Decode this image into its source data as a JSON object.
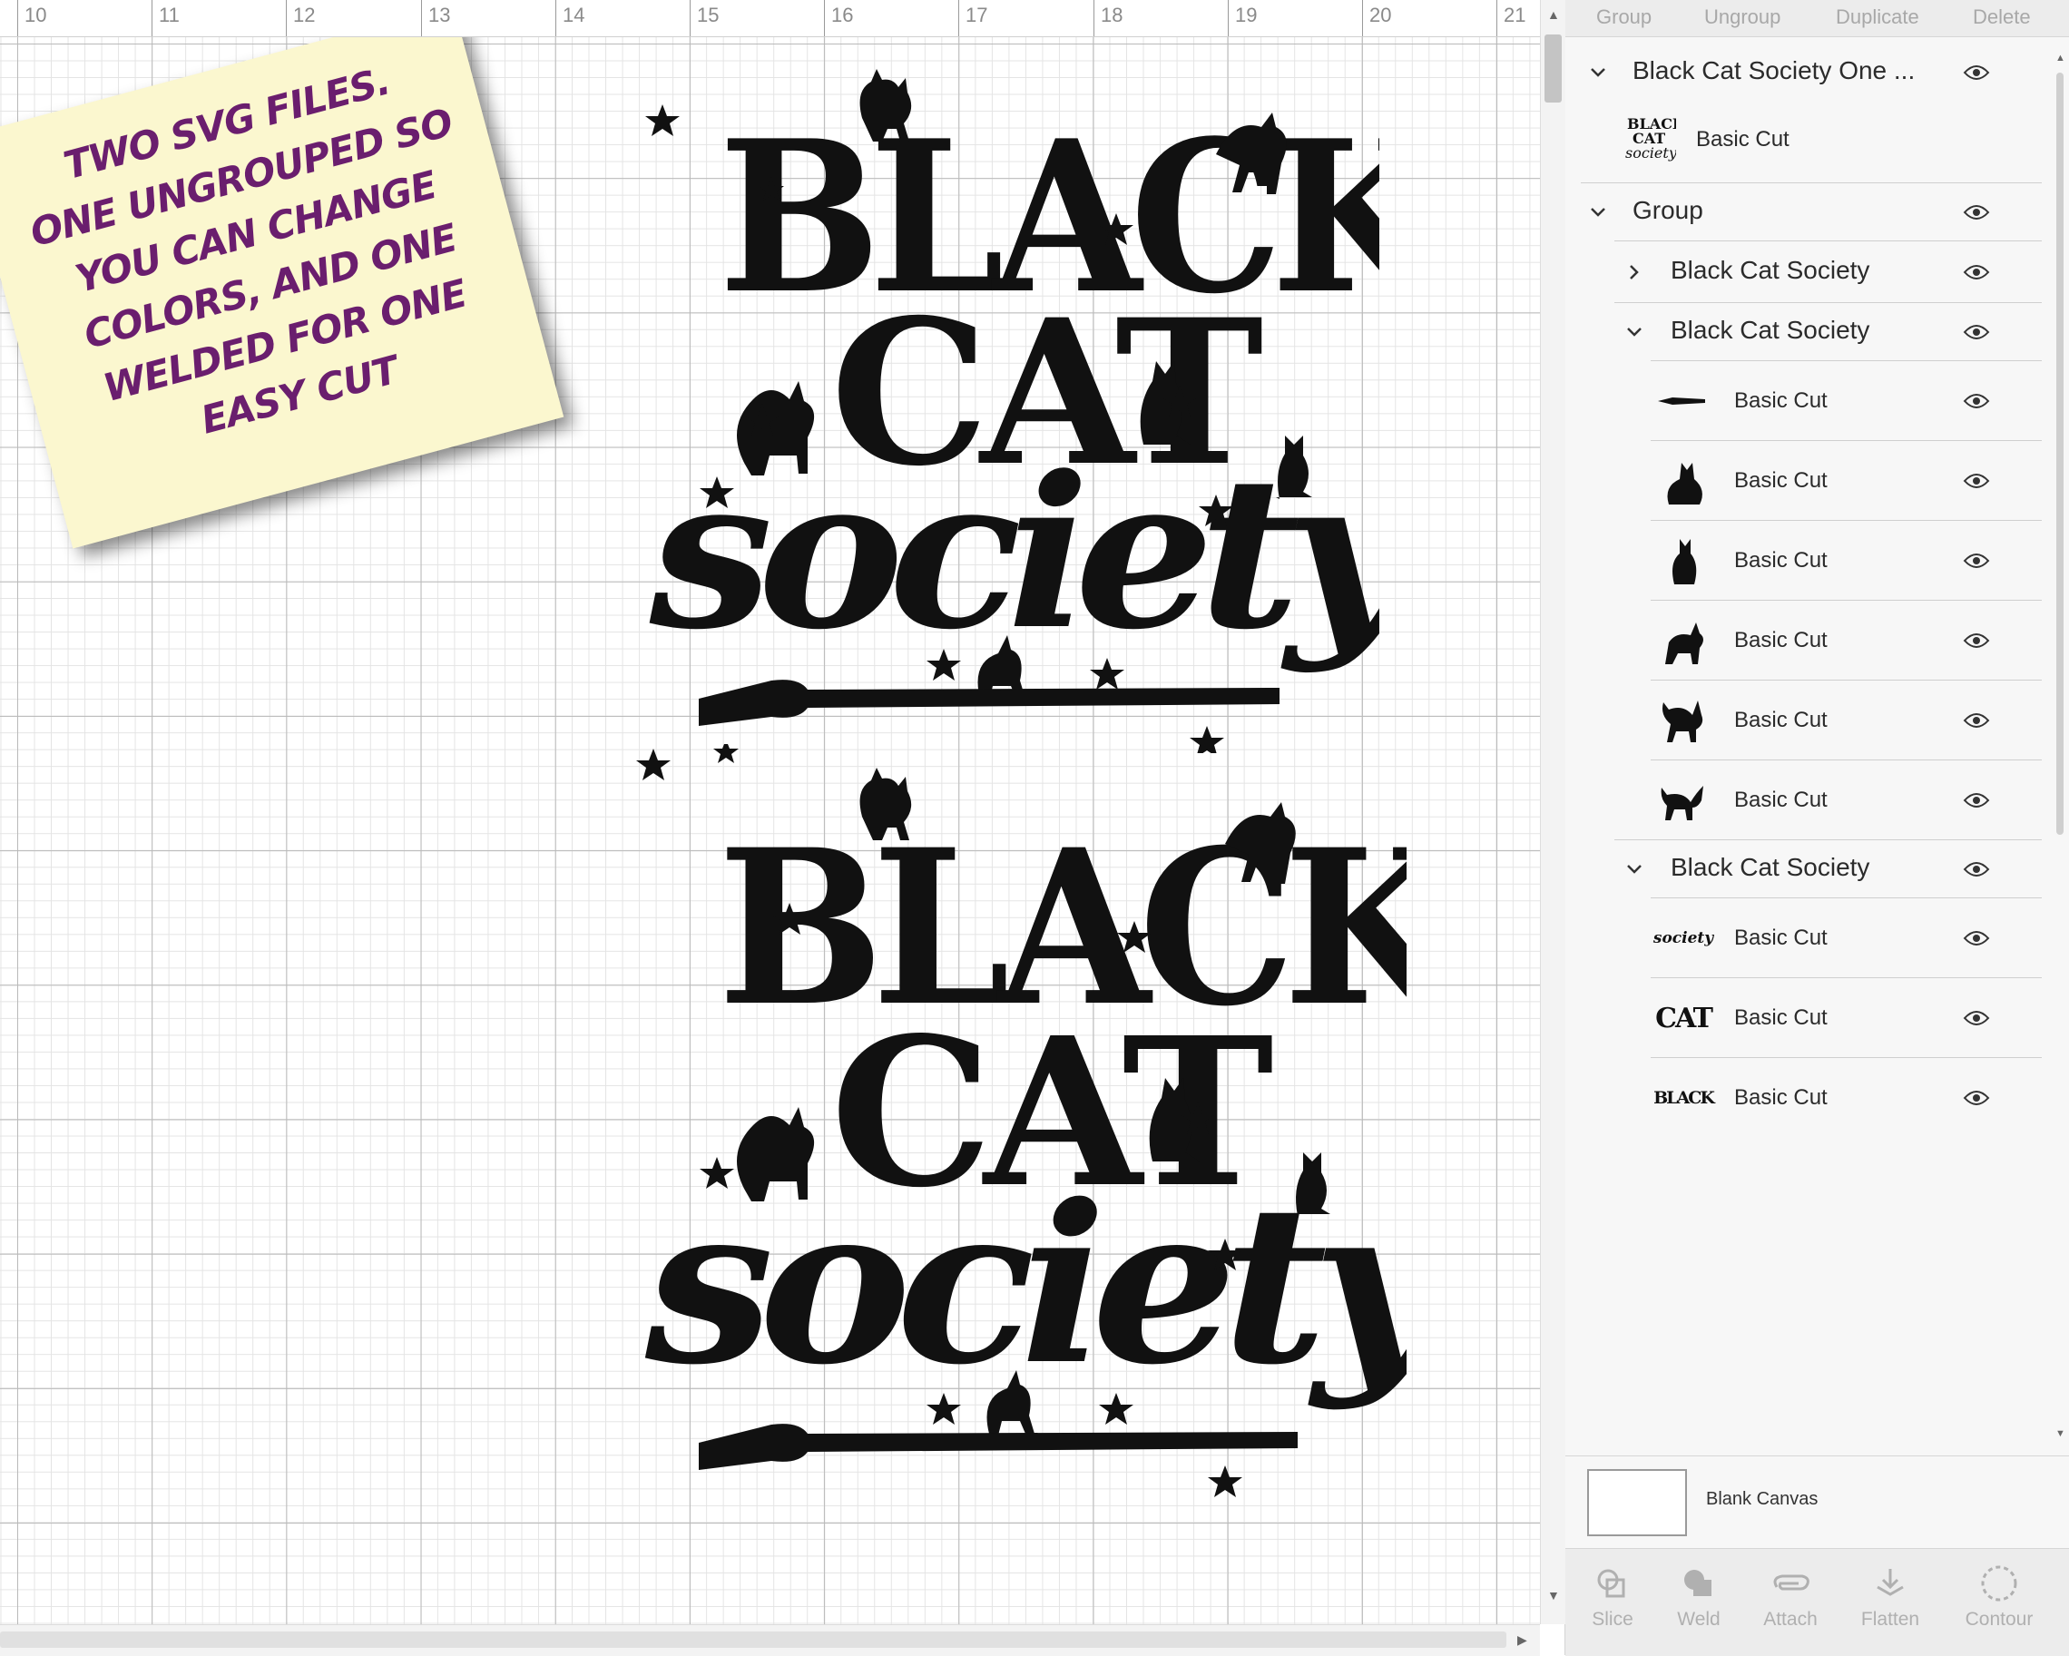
{
  "ruler": {
    "labels": [
      "10",
      "11",
      "12",
      "13",
      "14",
      "15",
      "16",
      "17",
      "18",
      "19",
      "20",
      "21"
    ]
  },
  "note": {
    "text": "TWO SVG FILES.\nONE UNGROUPED SO\nYOU CAN CHANGE\nCOLORS, AND ONE\nWELDED FOR ONE\nEASY CUT"
  },
  "artwork": {
    "words": [
      "BLACK",
      "CAT",
      "society"
    ],
    "color": "#111111"
  },
  "toolbar": {
    "group": "Group",
    "ungroup": "Ungroup",
    "duplicate": "Duplicate",
    "delete": "Delete"
  },
  "layers": {
    "top_group": {
      "name": "Black Cat Society One ...",
      "child": "Basic Cut"
    },
    "group": {
      "name": "Group",
      "sub1": "Black Cat Society",
      "sub2": "Black Cat Society",
      "sub2_items": [
        "Basic Cut",
        "Basic Cut",
        "Basic Cut",
        "Basic Cut",
        "Basic Cut",
        "Basic Cut"
      ],
      "sub3": "Black Cat Society",
      "sub3_items": [
        "Basic Cut",
        "Basic Cut",
        "Basic Cut"
      ],
      "sub3_thumbs": [
        "society",
        "CAT",
        "BLACK"
      ]
    }
  },
  "blank_canvas": "Blank Canvas",
  "bottom_actions": {
    "slice": "Slice",
    "weld": "Weld",
    "attach": "Attach",
    "flatten": "Flatten",
    "contour": "Contour"
  },
  "colors": {
    "accent_text": "#6a1e6e",
    "note_bg": "#fbf7cf",
    "ink": "#111111"
  }
}
